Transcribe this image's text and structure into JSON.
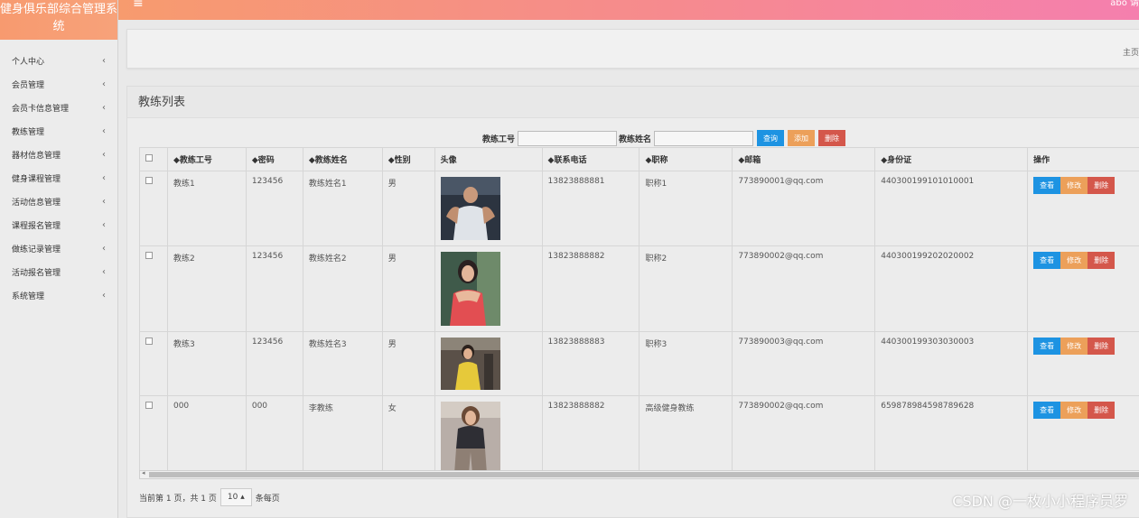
{
  "app": {
    "title": "健身俱乐部综合管理系统"
  },
  "sidebar": {
    "items": [
      {
        "label": "个人中心"
      },
      {
        "label": "会员管理"
      },
      {
        "label": "会员卡信息管理"
      },
      {
        "label": "教练管理"
      },
      {
        "label": "器材信息管理"
      },
      {
        "label": "健身课程管理"
      },
      {
        "label": "活动信息管理"
      },
      {
        "label": "课程报名管理"
      },
      {
        "label": "做练记录管理"
      },
      {
        "label": "活动报名管理"
      },
      {
        "label": "系统管理"
      }
    ],
    "chevron": "‹"
  },
  "topbar": {
    "menu_icon": "≡",
    "user": "abo   请登"
  },
  "breadcrumb": {
    "text": "主页"
  },
  "panel": {
    "title": "教练列表"
  },
  "search": {
    "id_label": "教练工号",
    "name_label": "教练姓名",
    "query_label": "查询",
    "add_label": "添加",
    "delete_label": "删除"
  },
  "table": {
    "headers": [
      "◆教练工号",
      "◆密码",
      "◆教练姓名",
      "◆性别",
      "头像",
      "◆联系电话",
      "◆职称",
      "◆邮箱",
      "◆身份证",
      "操作"
    ],
    "view_label": "查看",
    "edit_label": "修改",
    "delete_label": "删除",
    "rows": [
      {
        "id": "教练1",
        "password": "123456",
        "name": "教练姓名1",
        "gender": "男",
        "phone": "13823888881",
        "title": "职称1",
        "email": "773890001@qq.com",
        "idcard": "440300199101010001",
        "photo": "coach-1"
      },
      {
        "id": "教练2",
        "password": "123456",
        "name": "教练姓名2",
        "gender": "男",
        "phone": "13823888882",
        "title": "职称2",
        "email": "773890002@qq.com",
        "idcard": "440300199202020002",
        "photo": "coach-2"
      },
      {
        "id": "教练3",
        "password": "123456",
        "name": "教练姓名3",
        "gender": "男",
        "phone": "13823888883",
        "title": "职称3",
        "email": "773890003@qq.com",
        "idcard": "440300199303030003",
        "photo": "coach-3"
      },
      {
        "id": "000",
        "password": "000",
        "name": "李教练",
        "gender": "女",
        "phone": "13823888882",
        "title": "高级健身教练",
        "email": "773890002@qq.com",
        "idcard": "659878984598789628",
        "photo": "coach-4"
      }
    ]
  },
  "pager": {
    "text": "当前第 1 页，共 1 页",
    "page_size": "10 ▴",
    "per_page": "条每页"
  },
  "watermark": "CSDN @一枚小小程序员罗"
}
